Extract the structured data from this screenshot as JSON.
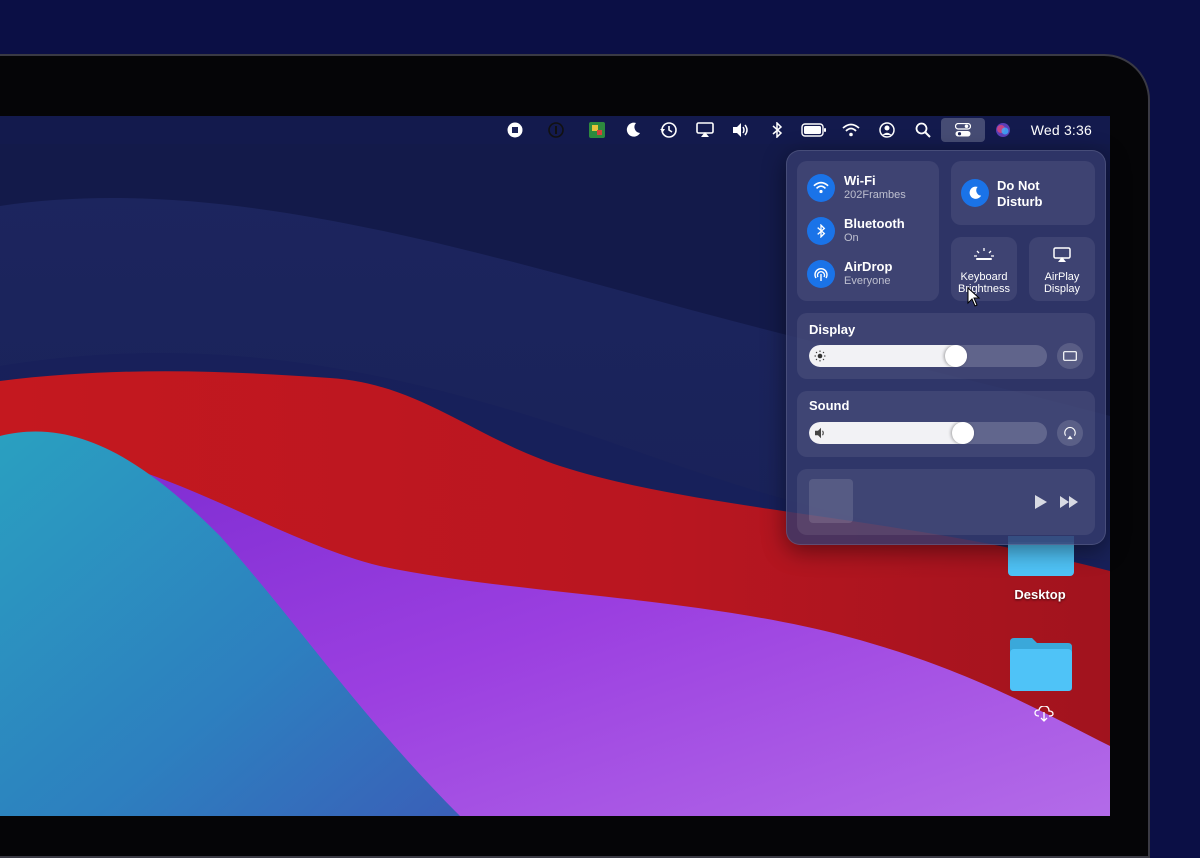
{
  "menubar": {
    "clock": "Wed 3:36",
    "icons": [
      "stop-record-icon",
      "info-icon",
      "app-icon",
      "moon-icon",
      "time-machine-icon",
      "airplay-icon",
      "volume-icon",
      "bluetooth-icon",
      "battery-icon",
      "wifi-icon",
      "user-icon",
      "search-icon",
      "control-center-icon",
      "siri-icon"
    ]
  },
  "control_center": {
    "wifi": {
      "title": "Wi-Fi",
      "subtitle": "202Frambes"
    },
    "bluetooth": {
      "title": "Bluetooth",
      "subtitle": "On"
    },
    "airdrop": {
      "title": "AirDrop",
      "subtitle": "Everyone"
    },
    "dnd": {
      "line1": "Do Not",
      "line2": "Disturb"
    },
    "keyboard": {
      "line1": "Keyboard",
      "line2": "Brightness"
    },
    "airplay": {
      "line1": "AirPlay",
      "line2": "Display"
    },
    "display": {
      "title": "Display",
      "level": 0.63
    },
    "sound": {
      "title": "Sound",
      "level": 0.66
    }
  },
  "desktop": {
    "folders": [
      {
        "label": "Desktop"
      },
      {
        "label": ""
      }
    ]
  },
  "colors": {
    "accent": "#1a73e8",
    "background": "#0b0f45",
    "folder": "#4fc3f7"
  }
}
